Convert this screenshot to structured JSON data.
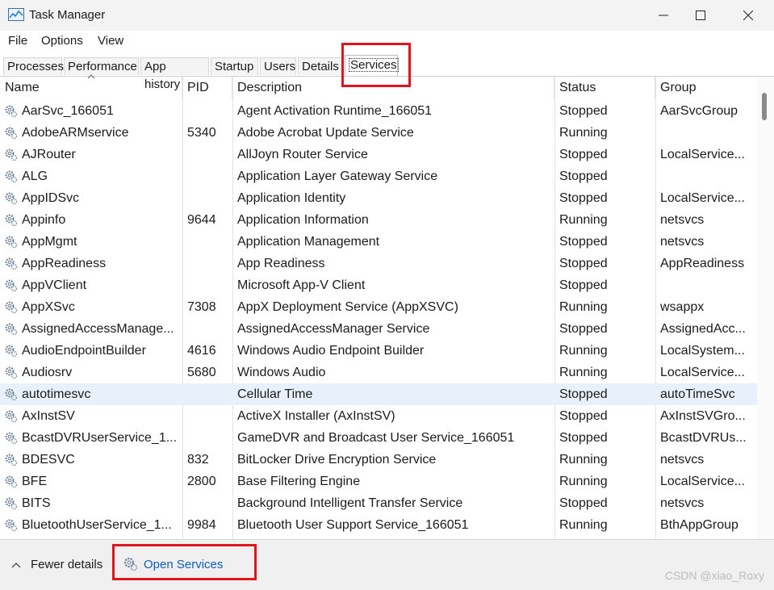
{
  "window": {
    "title": "Task Manager",
    "app_icon": "task-manager-icon",
    "controls": {
      "minimize": "minimize-icon",
      "maximize": "maximize-icon",
      "close": "close-icon"
    }
  },
  "menu": [
    {
      "label": "File"
    },
    {
      "label": "Options"
    },
    {
      "label": "View"
    }
  ],
  "tabs": [
    {
      "label": "Processes"
    },
    {
      "label": "Performance"
    },
    {
      "label": "App history"
    },
    {
      "label": "Startup"
    },
    {
      "label": "Users"
    },
    {
      "label": "Details"
    },
    {
      "label": "Services",
      "active": true
    }
  ],
  "columns": [
    "Name",
    "PID",
    "Description",
    "Status",
    "Group"
  ],
  "rows": [
    {
      "name": "AarSvc_166051",
      "pid": "",
      "description": "Agent Activation Runtime_166051",
      "status": "Stopped",
      "group": "AarSvcGroup"
    },
    {
      "name": "AdobeARMservice",
      "pid": "5340",
      "description": "Adobe Acrobat Update Service",
      "status": "Running",
      "group": ""
    },
    {
      "name": "AJRouter",
      "pid": "",
      "description": "AllJoyn Router Service",
      "status": "Stopped",
      "group": "LocalService..."
    },
    {
      "name": "ALG",
      "pid": "",
      "description": "Application Layer Gateway Service",
      "status": "Stopped",
      "group": ""
    },
    {
      "name": "AppIDSvc",
      "pid": "",
      "description": "Application Identity",
      "status": "Stopped",
      "group": "LocalService..."
    },
    {
      "name": "Appinfo",
      "pid": "9644",
      "description": "Application Information",
      "status": "Running",
      "group": "netsvcs"
    },
    {
      "name": "AppMgmt",
      "pid": "",
      "description": "Application Management",
      "status": "Stopped",
      "group": "netsvcs"
    },
    {
      "name": "AppReadiness",
      "pid": "",
      "description": "App Readiness",
      "status": "Stopped",
      "group": "AppReadiness"
    },
    {
      "name": "AppVClient",
      "pid": "",
      "description": "Microsoft App-V Client",
      "status": "Stopped",
      "group": ""
    },
    {
      "name": "AppXSvc",
      "pid": "7308",
      "description": "AppX Deployment Service (AppXSVC)",
      "status": "Running",
      "group": "wsappx"
    },
    {
      "name": "AssignedAccessManage...",
      "pid": "",
      "description": "AssignedAccessManager Service",
      "status": "Stopped",
      "group": "AssignedAcc..."
    },
    {
      "name": "AudioEndpointBuilder",
      "pid": "4616",
      "description": "Windows Audio Endpoint Builder",
      "status": "Running",
      "group": "LocalSystem..."
    },
    {
      "name": "Audiosrv",
      "pid": "5680",
      "description": "Windows Audio",
      "status": "Running",
      "group": "LocalService..."
    },
    {
      "name": "autotimesvc",
      "pid": "",
      "description": "Cellular Time",
      "status": "Stopped",
      "group": "autoTimeSvc",
      "selected": true
    },
    {
      "name": "AxInstSV",
      "pid": "",
      "description": "ActiveX Installer (AxInstSV)",
      "status": "Stopped",
      "group": "AxInstSVGro..."
    },
    {
      "name": "BcastDVRUserService_1...",
      "pid": "",
      "description": "GameDVR and Broadcast User Service_166051",
      "status": "Stopped",
      "group": "BcastDVRUs..."
    },
    {
      "name": "BDESVC",
      "pid": "832",
      "description": "BitLocker Drive Encryption Service",
      "status": "Running",
      "group": "netsvcs"
    },
    {
      "name": "BFE",
      "pid": "2800",
      "description": "Base Filtering Engine",
      "status": "Running",
      "group": "LocalService..."
    },
    {
      "name": "BITS",
      "pid": "",
      "description": "Background Intelligent Transfer Service",
      "status": "Stopped",
      "group": "netsvcs"
    },
    {
      "name": "BluetoothUserService_1...",
      "pid": "9984",
      "description": "Bluetooth User Support Service_166051",
      "status": "Running",
      "group": "BthAppGroup"
    }
  ],
  "footer": {
    "fewer_details": "Fewer details",
    "open_services": "Open Services"
  },
  "watermark": "CSDN @xiao_Roxy",
  "colors": {
    "accent_link": "#0a5fbf",
    "highlight_box": "#e0141e",
    "selected_row": "#e8f1fb"
  }
}
